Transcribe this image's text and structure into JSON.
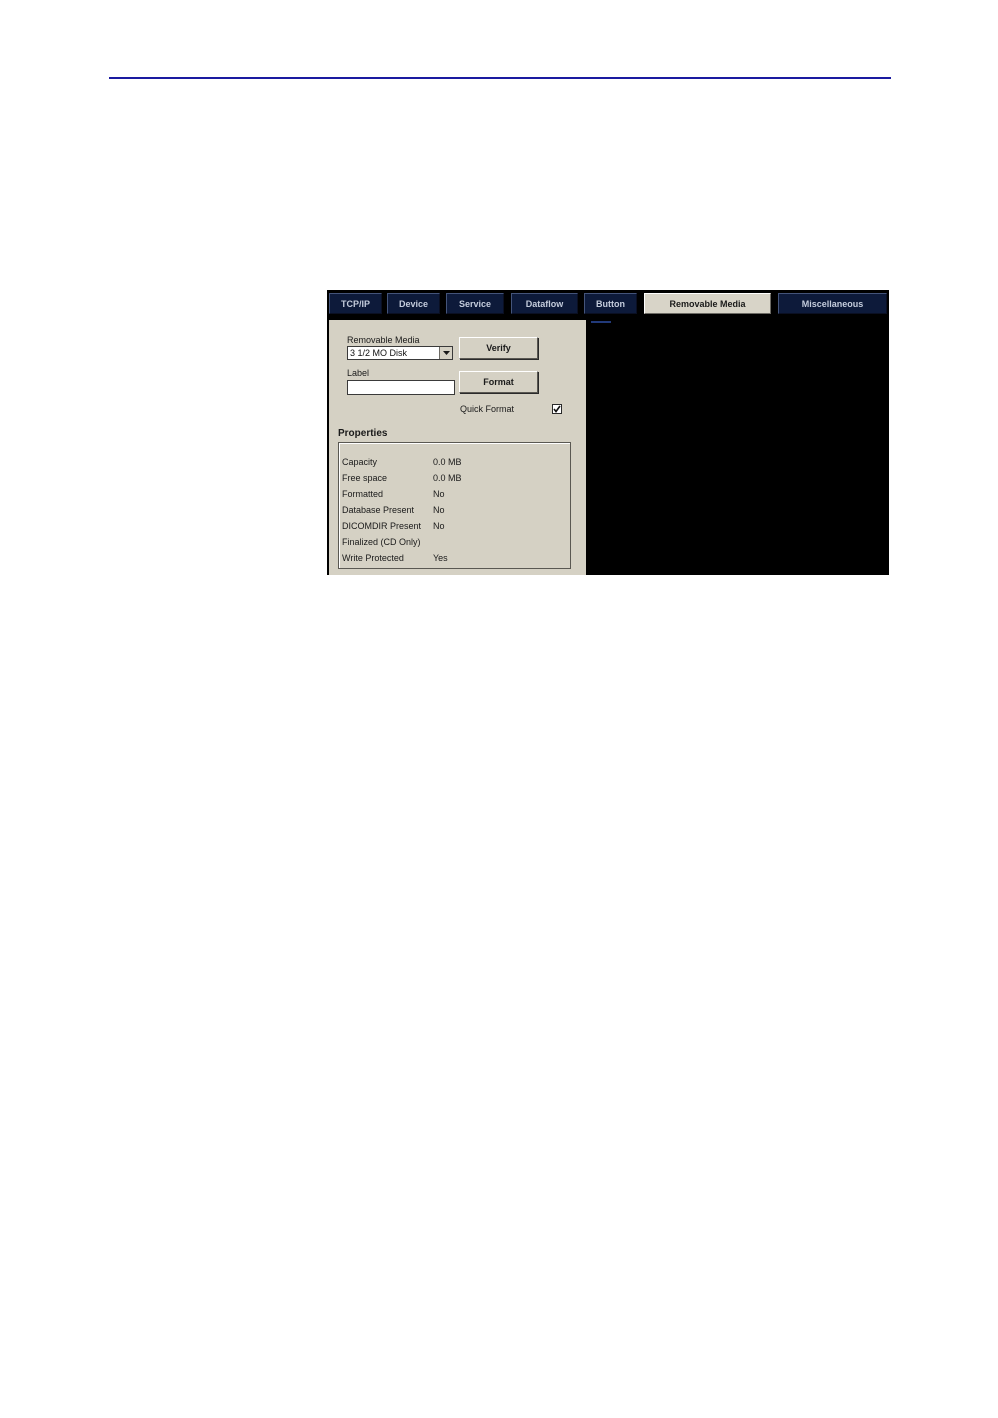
{
  "tabs": [
    {
      "label": "TCP/IP"
    },
    {
      "label": "Device"
    },
    {
      "label": "Service"
    },
    {
      "label": "Dataflow"
    },
    {
      "label": "Button"
    },
    {
      "label": "Removable Media",
      "active": true
    },
    {
      "label": "Miscellaneous"
    }
  ],
  "media": {
    "label": "Removable Media",
    "selected": "3 1/2 MO Disk",
    "arrow_icon": "chevron-down-icon"
  },
  "label_field": {
    "label": "Label",
    "value": ""
  },
  "buttons": {
    "verify": "Verify",
    "format": "Format"
  },
  "quick_format": {
    "label": "Quick Format",
    "checked": true
  },
  "properties": {
    "title": "Properties",
    "rows": [
      {
        "name": "Capacity",
        "value": "0.0 MB"
      },
      {
        "name": "Free space",
        "value": "0.0 MB"
      },
      {
        "name": "Formatted",
        "value": "No"
      },
      {
        "name": "Database Present",
        "value": "No"
      },
      {
        "name": "DICOMDIR Present",
        "value": "No"
      },
      {
        "name": "Finalized (CD Only)",
        "value": ""
      },
      {
        "name": "Write Protected",
        "value": "Yes"
      }
    ]
  },
  "colors": {
    "rule": "#1a1aa0",
    "tab_bg": "#0d1a3a",
    "panel_bg": "#d5d1c4",
    "screen_bg": "#000000"
  }
}
